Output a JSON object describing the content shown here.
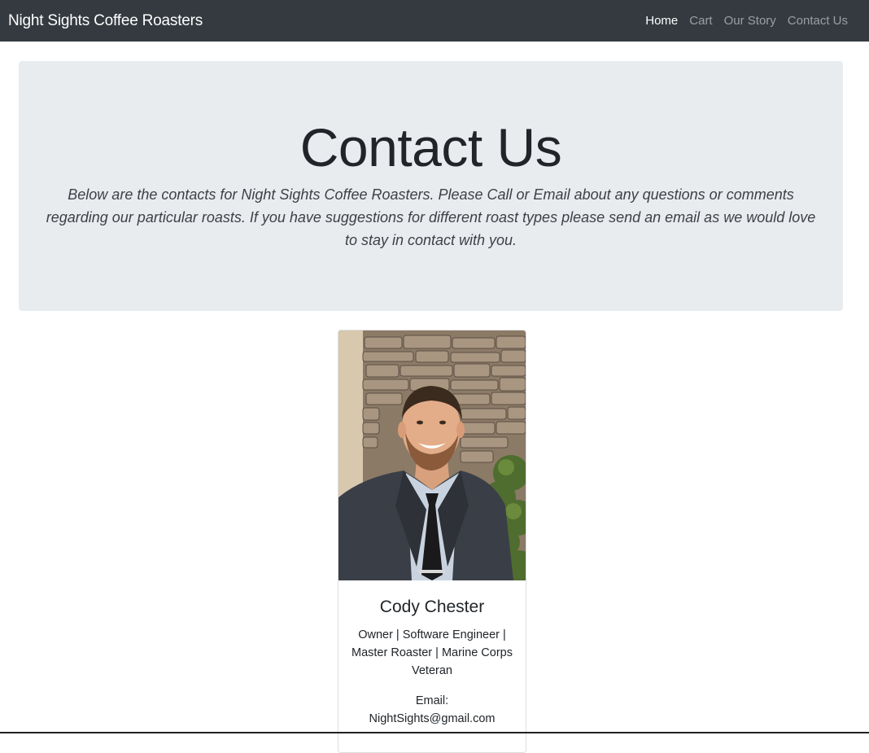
{
  "navbar": {
    "brand": "Night Sights Coffee Roasters",
    "links": [
      {
        "label": "Home",
        "active": true
      },
      {
        "label": "Cart",
        "active": false
      },
      {
        "label": "Our Story",
        "active": false
      },
      {
        "label": "Contact Us",
        "active": false
      }
    ]
  },
  "hero": {
    "title": "Contact Us",
    "lead": "Below are the contacts for Night Sights Coffee Roasters. Please Call or Email about any questions or comments regarding our particular roasts. If you have suggestions for different roast types please send an email as we would love to stay in contact with you."
  },
  "contact_card": {
    "name": "Cody Chester",
    "role": "Owner | Software Engineer | Master Roaster | Marine Corps Veteran",
    "email_label": "Email:",
    "email": "NightSights@gmail.com",
    "photo_alt": "portrait-photo"
  },
  "colors": {
    "navbar_bg": "#343a40",
    "jumbotron_bg": "#e9ecef",
    "text": "#212529"
  }
}
